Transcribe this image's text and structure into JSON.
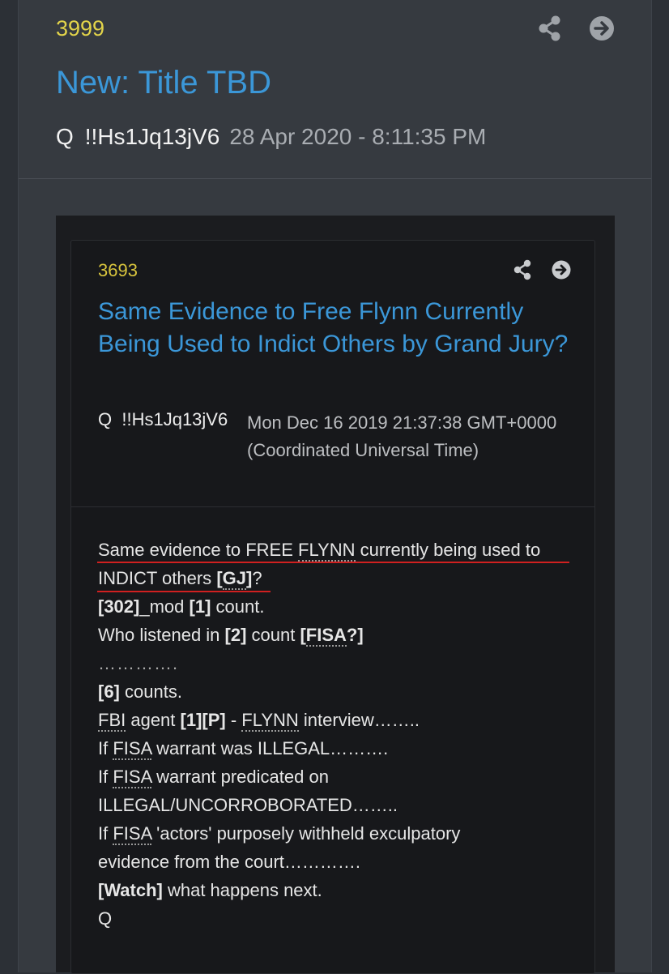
{
  "post": {
    "number": "3999",
    "title": "New: Title TBD",
    "author": "Q",
    "tripcode": "!!Hs1Jq13jV6",
    "timestamp": "28 Apr 2020 - 8:11:35 PM",
    "icons": [
      "share-icon",
      "arrow-right-circle-icon"
    ]
  },
  "quoted": {
    "number": "3693",
    "title": "Same Evidence to Free Flynn Currently Being Used to Indict Others by Grand Jury?",
    "author": "Q",
    "tripcode": "!!Hs1Jq13jV6",
    "timestamp": "Mon Dec 16 2019 21:37:38 GMT+0000 (Coordinated Universal Time)",
    "body": {
      "l1_a": "Same evidence to FREE ",
      "l1_b": "FLYNN",
      "l1_c": " currently being used to",
      "l2_a": "INDICT others ",
      "l2_b": "[",
      "l2_c": "GJ",
      "l2_d": "]",
      "l2_e": "?",
      "l3_a": "[302]",
      "l3_b": "_mod ",
      "l3_c": "[1]",
      "l3_d": " count.",
      "l4_a": "Who listened in ",
      "l4_b": "[2]",
      "l4_c": " count ",
      "l4_d": "[",
      "l4_e": "FISA",
      "l4_f": "?]",
      "l5": "………….",
      "l6_a": "[6]",
      "l6_b": " counts.",
      "l7_a": "FBI",
      "l7_b": " agent ",
      "l7_c": "[1][P]",
      "l7_d": " - ",
      "l7_e": "FLYNN",
      "l7_f": " interview……..",
      "l8_a": "If ",
      "l8_b": "FISA",
      "l8_c": " warrant was ILLEGAL……….",
      "l9_a": "If ",
      "l9_b": "FISA",
      "l9_c": " warrant predicated on",
      "l10": "ILLEGAL/UNCORROBORATED……..",
      "l11_a": "If ",
      "l11_b": "FISA",
      "l11_c": " 'actors' purposely withheld exculpatory",
      "l12": "evidence from the court………….",
      "l13_a": "[Watch]",
      "l13_b": " what happens next.",
      "l14": "Q"
    }
  },
  "colors": {
    "accent_link": "#3b97d8",
    "post_number": "#e3d44a",
    "underline": "#d02020"
  }
}
